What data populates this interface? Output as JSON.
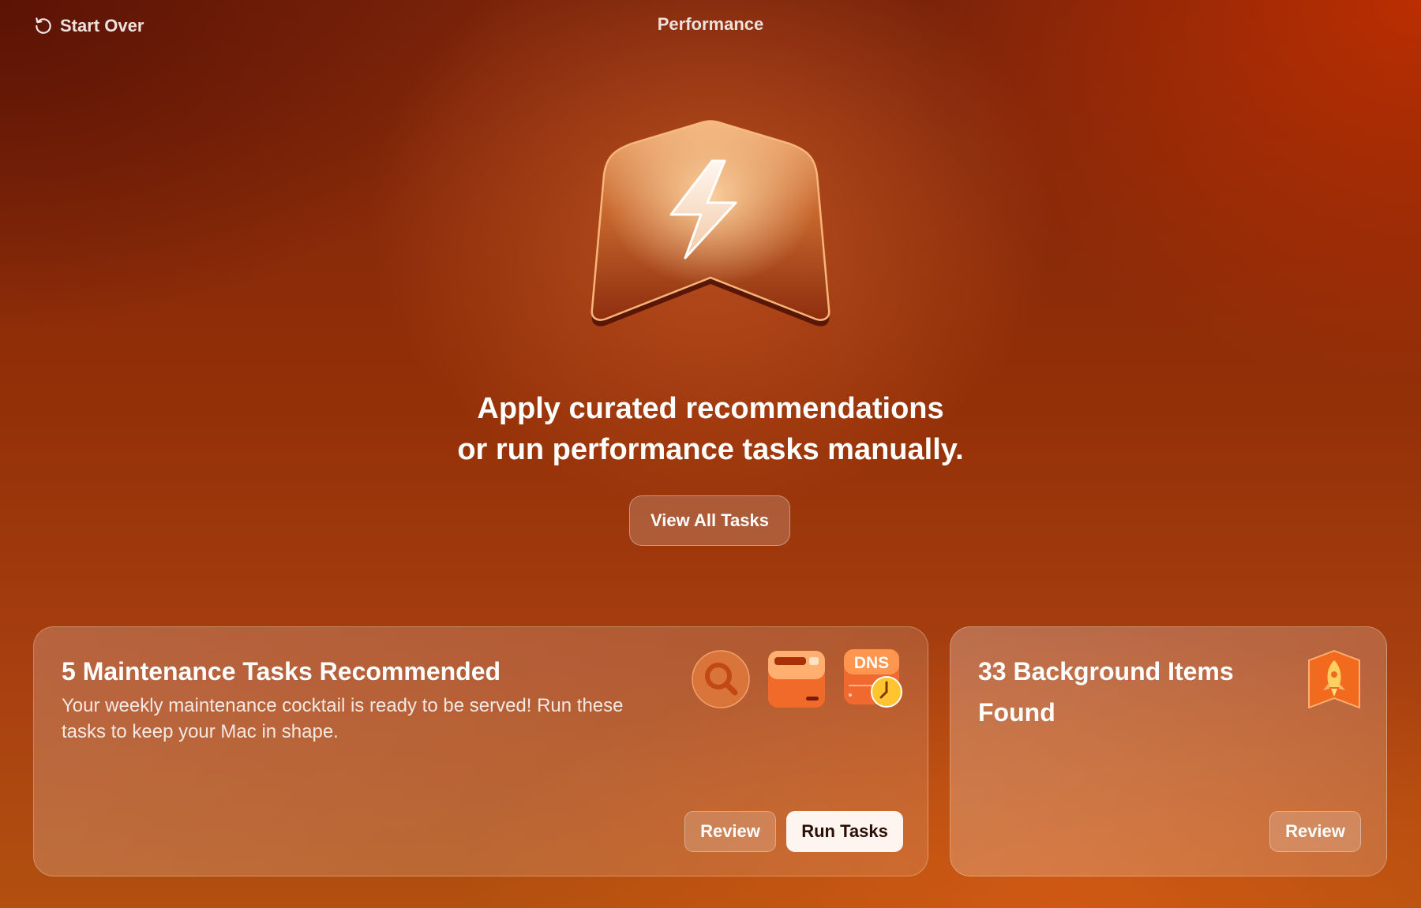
{
  "topbar": {
    "start_over_label": "Start Over",
    "title": "Performance"
  },
  "hero": {
    "headline_line1": "Apply curated recommendations",
    "headline_line2": "or run performance tasks manually.",
    "view_all_label": "View All Tasks"
  },
  "maintenance_card": {
    "title": "5 Maintenance Tasks Recommended",
    "description": "Your weekly maintenance cocktail is ready to be served! Run these tasks to keep your Mac in shape.",
    "icons": [
      "search-icon",
      "disk-icon",
      "dns-icon"
    ],
    "dns_label": "DNS",
    "review_label": "Review",
    "run_label": "Run Tasks"
  },
  "background_card": {
    "title": "33 Background Items Found",
    "icon": "rocket-icon",
    "review_label": "Review"
  },
  "colors": {
    "accent": "#e86a2a",
    "button_primary_bg": "#fff5f0"
  }
}
